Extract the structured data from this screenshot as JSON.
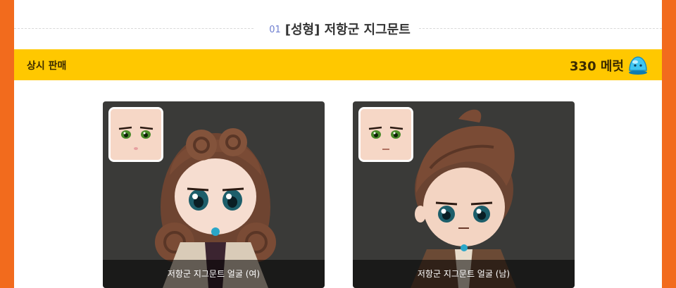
{
  "section": {
    "number": "01",
    "title": "[성형] 저항군 지그문트"
  },
  "sale_bar": {
    "label": "상시 판매",
    "price": "330 메럿",
    "coin_icon": "blue-slime-coin-icon"
  },
  "cards": [
    {
      "caption": "저항군 지그문트 얼굴 (여)"
    },
    {
      "caption": "저항군 지그문트 얼굴 (남)"
    }
  ],
  "colors": {
    "background_orange": "#f26b1d",
    "sale_bar_yellow": "#ffc800",
    "card_dark": "#3a3a38",
    "section_number_blue": "#6f7fd0"
  }
}
